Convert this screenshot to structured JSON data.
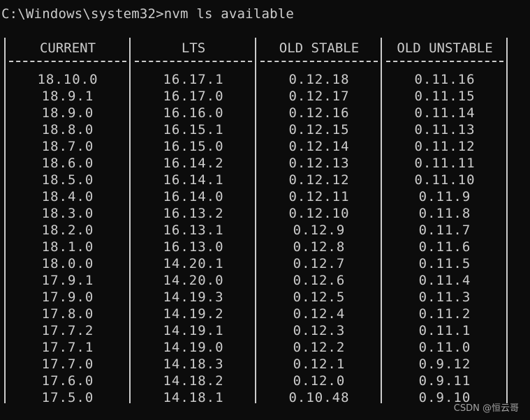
{
  "terminal": {
    "prompt_line": "C:\\Windows\\system32>nvm ls available",
    "watermark": "CSDN @恒云哥"
  },
  "table": {
    "headers": [
      "CURRENT",
      "LTS",
      "OLD STABLE",
      "OLD UNSTABLE"
    ],
    "rows": [
      [
        "18.10.0",
        "16.17.1",
        "0.12.18",
        "0.11.16"
      ],
      [
        "18.9.1",
        "16.17.0",
        "0.12.17",
        "0.11.15"
      ],
      [
        "18.9.0",
        "16.16.0",
        "0.12.16",
        "0.11.14"
      ],
      [
        "18.8.0",
        "16.15.1",
        "0.12.15",
        "0.11.13"
      ],
      [
        "18.7.0",
        "16.15.0",
        "0.12.14",
        "0.11.12"
      ],
      [
        "18.6.0",
        "16.14.2",
        "0.12.13",
        "0.11.11"
      ],
      [
        "18.5.0",
        "16.14.1",
        "0.12.12",
        "0.11.10"
      ],
      [
        "18.4.0",
        "16.14.0",
        "0.12.11",
        "0.11.9"
      ],
      [
        "18.3.0",
        "16.13.2",
        "0.12.10",
        "0.11.8"
      ],
      [
        "18.2.0",
        "16.13.1",
        "0.12.9",
        "0.11.7"
      ],
      [
        "18.1.0",
        "16.13.0",
        "0.12.8",
        "0.11.6"
      ],
      [
        "18.0.0",
        "14.20.1",
        "0.12.7",
        "0.11.5"
      ],
      [
        "17.9.1",
        "14.20.0",
        "0.12.6",
        "0.11.4"
      ],
      [
        "17.9.0",
        "14.19.3",
        "0.12.5",
        "0.11.3"
      ],
      [
        "17.8.0",
        "14.19.2",
        "0.12.4",
        "0.11.2"
      ],
      [
        "17.7.2",
        "14.19.1",
        "0.12.3",
        "0.11.1"
      ],
      [
        "17.7.1",
        "14.19.0",
        "0.12.2",
        "0.11.0"
      ],
      [
        "17.7.0",
        "14.18.3",
        "0.12.1",
        "0.9.12"
      ],
      [
        "17.6.0",
        "14.18.2",
        "0.12.0",
        "0.9.11"
      ],
      [
        "17.5.0",
        "14.18.1",
        "0.10.48",
        "0.9.10"
      ]
    ]
  }
}
